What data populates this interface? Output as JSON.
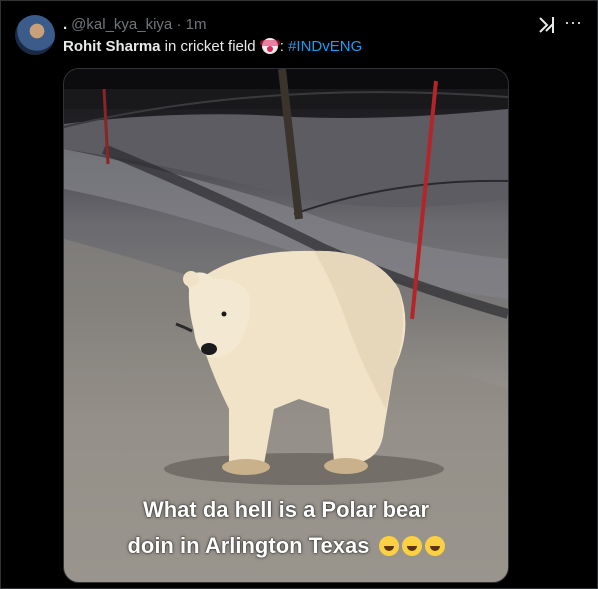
{
  "tweet": {
    "separator_dot": ".",
    "handle": "@kal_kya_kiya",
    "time": "· 1m",
    "author_name_bold": "Rohit Sharma",
    "text_middle": " in cricket field ",
    "text_colon": ": ",
    "hashtag": "#INDvENG",
    "emoji": "clown-face-icon"
  },
  "actions": {
    "grok_icon": "grok-icon",
    "more_label": "···"
  },
  "media": {
    "caption_line1": "What da hell is a Polar bear",
    "caption_line2": "doin in Arlington Texas",
    "caption_emoji": "face-with-tears-of-joy-icon"
  },
  "colors": {
    "background": "#000000",
    "text": "#e7e9ea",
    "muted": "#71767b",
    "hashtag": "#1d9bf0",
    "border": "#2f3336"
  }
}
